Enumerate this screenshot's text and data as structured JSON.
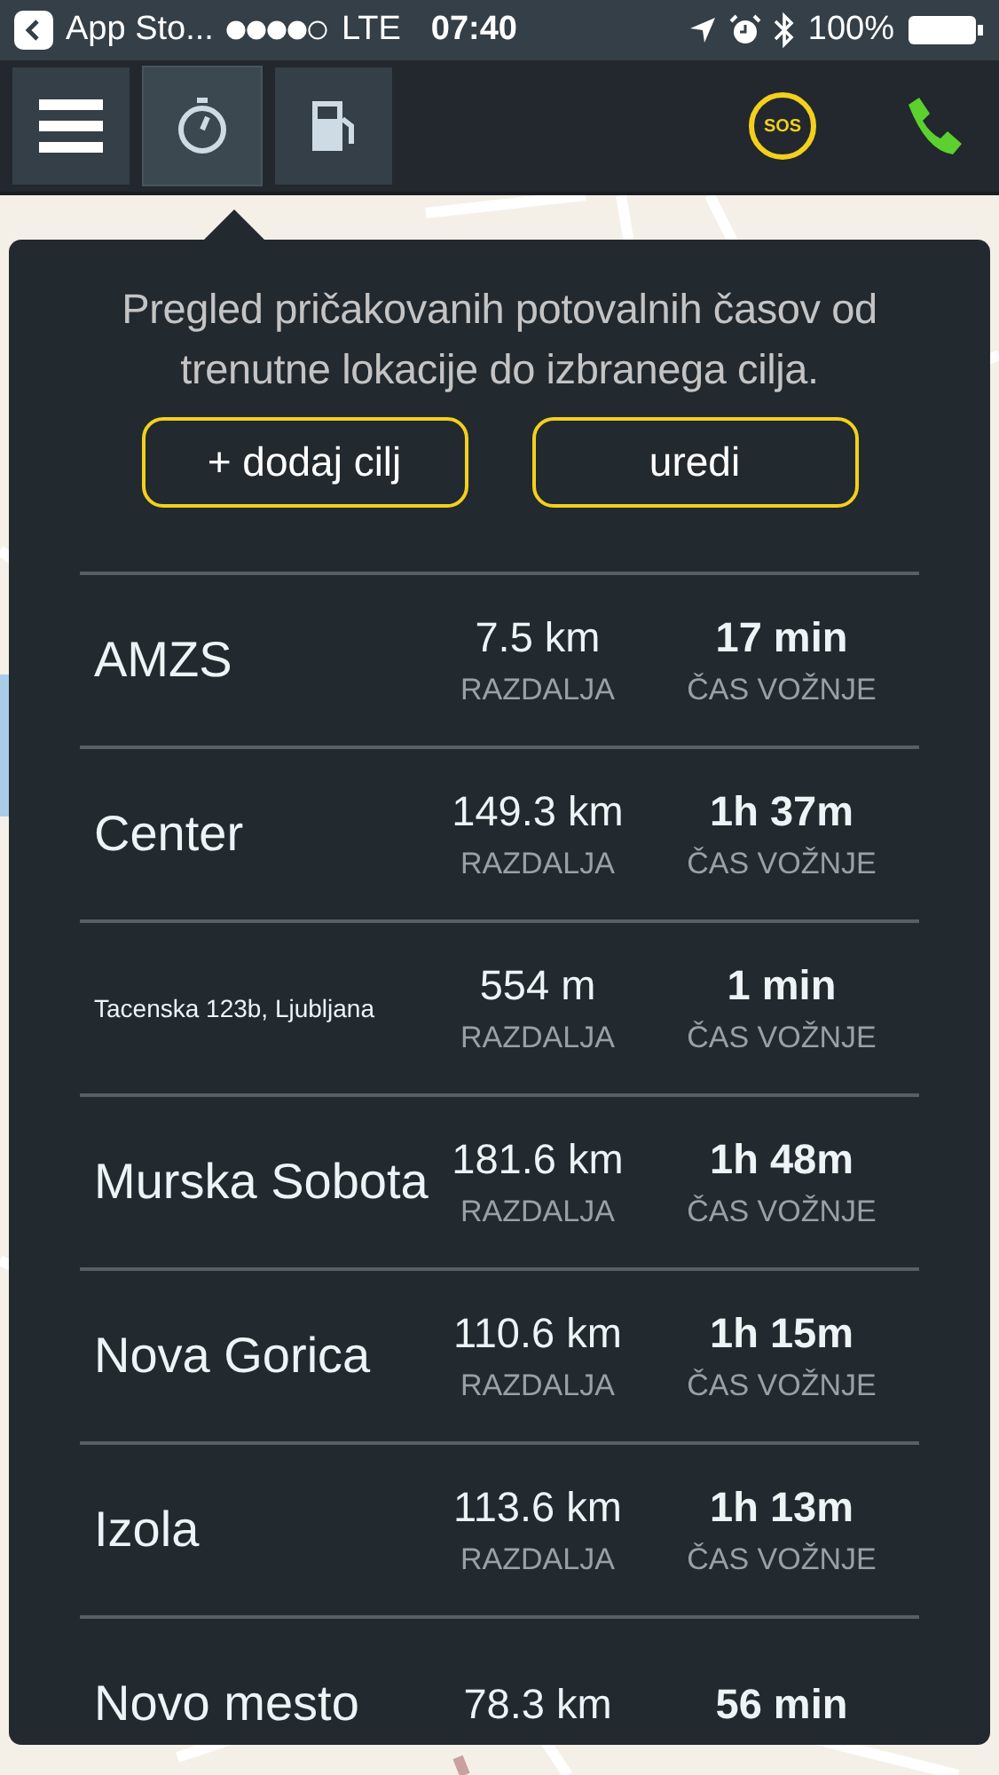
{
  "status_bar": {
    "back_label": "App Sto...",
    "network": "LTE",
    "time": "07:40",
    "battery": "100%"
  },
  "toolbar": {
    "tabs": [
      {
        "kind": "menu",
        "selected": false
      },
      {
        "kind": "stopwatch",
        "selected": true
      },
      {
        "kind": "fuel",
        "selected": false
      }
    ],
    "sos": "SOS"
  },
  "panel": {
    "intro": "Pregled pričakovanih potovalnih časov od trenutne lokacije do izbranega cilja.",
    "buttons": [
      "+ dodaj cilj",
      "uredi"
    ],
    "rows": [
      {
        "name": "AMZS",
        "small": false,
        "distance": "7.5 km",
        "distance_label": "RAZDALJA",
        "time": "17 min",
        "time_label": "ČAS VOŽNJE"
      },
      {
        "name": "Center",
        "small": false,
        "distance": "149.3 km",
        "distance_label": "RAZDALJA",
        "time": "1h 37m",
        "time_label": "ČAS VOŽNJE"
      },
      {
        "name": "Tacenska 123b, Ljubljana",
        "small": true,
        "distance": "554 m",
        "distance_label": "RAZDALJA",
        "time": "1 min",
        "time_label": "ČAS VOŽNJE"
      },
      {
        "name": "Murska Sobota",
        "small": false,
        "distance": "181.6 km",
        "distance_label": "RAZDALJA",
        "time": "1h 48m",
        "time_label": "ČAS VOŽNJE"
      },
      {
        "name": "Nova Gorica",
        "small": false,
        "distance": "110.6 km",
        "distance_label": "RAZDALJA",
        "time": "1h 15m",
        "time_label": "ČAS VOŽNJE"
      },
      {
        "name": "Izola",
        "small": false,
        "distance": "113.6 km",
        "distance_label": "RAZDALJA",
        "time": "1h 13m",
        "time_label": "ČAS VOŽNJE"
      },
      {
        "name": "Novo mesto",
        "small": false,
        "distance": "78.3 km",
        "time": "56 min"
      }
    ]
  }
}
